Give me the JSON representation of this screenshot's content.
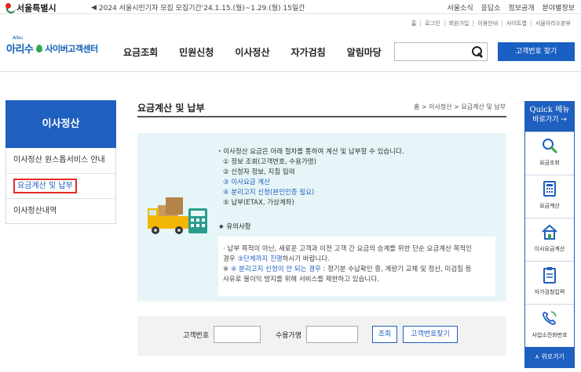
{
  "topbar": {
    "seoul_label": "서울특별시",
    "notice": "2024 서울시민기자 모집 모집기간'24.1.15.(월)~1.29.(월) 15일간",
    "links": [
      "서울소식",
      "응답소",
      "정보공개",
      "분야별정보"
    ]
  },
  "util": [
    "홈",
    "로그인",
    "회원가입",
    "이용안내",
    "사이트맵",
    "서울아리수본부"
  ],
  "header": {
    "brand_small": "Arisu",
    "brand_name": "아리수",
    "brand_center": "사이버고객센터",
    "gnb": [
      "요금조회",
      "민원신청",
      "이사정산",
      "자가검침",
      "알림마당"
    ],
    "search_placeholder": "",
    "find_button": "고객번호 찾기"
  },
  "sidebar": {
    "title": "이사정산",
    "items": [
      {
        "label": "이사정산 원스톱서비스 안내"
      },
      {
        "label": "요금계산 및 납부"
      },
      {
        "label": "이사정산내역"
      }
    ]
  },
  "content": {
    "title": "요금계산 및 납부",
    "breadcrumb": "홈 > 이사정산 > 요금계산 및 납부",
    "guide_lead": "이사정산 요금은 아래 절차를 통하여 계산 및 납부할 수 있습니다.",
    "steps": [
      {
        "text": "① 정보 조회(고객번호, 수용가명)",
        "link": false
      },
      {
        "text": "② 신청자 정보, 지침 입력",
        "link": false
      },
      {
        "text": "③ 이사요금 계산",
        "link": true
      },
      {
        "text": "④ 분리고지 신청(본인인증 필요)",
        "link": true
      },
      {
        "text": "⑤ 납부(ETAX, 가상계좌)",
        "link": false
      }
    ],
    "notice_title": "★ 유의사항",
    "notice_line1": "납부 목적이 아닌, 새로운 고객과 이전 고객 간 요금의 승계를 위한 단순 요금계산 목적인",
    "notice_line2a": "경우 ",
    "notice_line2b": "③단계까지 진행",
    "notice_line2c": "하시기 바랍니다.",
    "notice_line3a": "※ ",
    "notice_line3b": "④ 분리고지 신청이 안 되는 경우",
    "notice_line3c": " : 정기분 수납확인 중, 계량기 교체 및 정산, 미검침 등",
    "notice_line4": "사유로 불이익 방지를 위해 서비스를 제한하고 있습니다."
  },
  "form": {
    "customer_no_label": "고객번호",
    "customer_no_value": "",
    "user_name_label": "수용가명",
    "user_name_value": "",
    "lookup_button": "조회",
    "find_button": "고객번호찾기"
  },
  "quick": {
    "title": "Quick 메뉴",
    "subtitle": "바로가기 →",
    "items": [
      {
        "label": "요금조회",
        "icon": "magnifier-icon"
      },
      {
        "label": "요금계산",
        "icon": "calculator-icon"
      },
      {
        "label": "이사요금계산",
        "icon": "house-icon"
      },
      {
        "label": "자가검침입력",
        "icon": "clipboard-icon"
      },
      {
        "label": "사업소전화번호",
        "icon": "phone-icon"
      }
    ],
    "top_button": "∧ 위로가기"
  },
  "colors": {
    "primary": "#1f5fbf",
    "info_bg": "#e6f5f7",
    "highlight": "#e52a2a"
  }
}
